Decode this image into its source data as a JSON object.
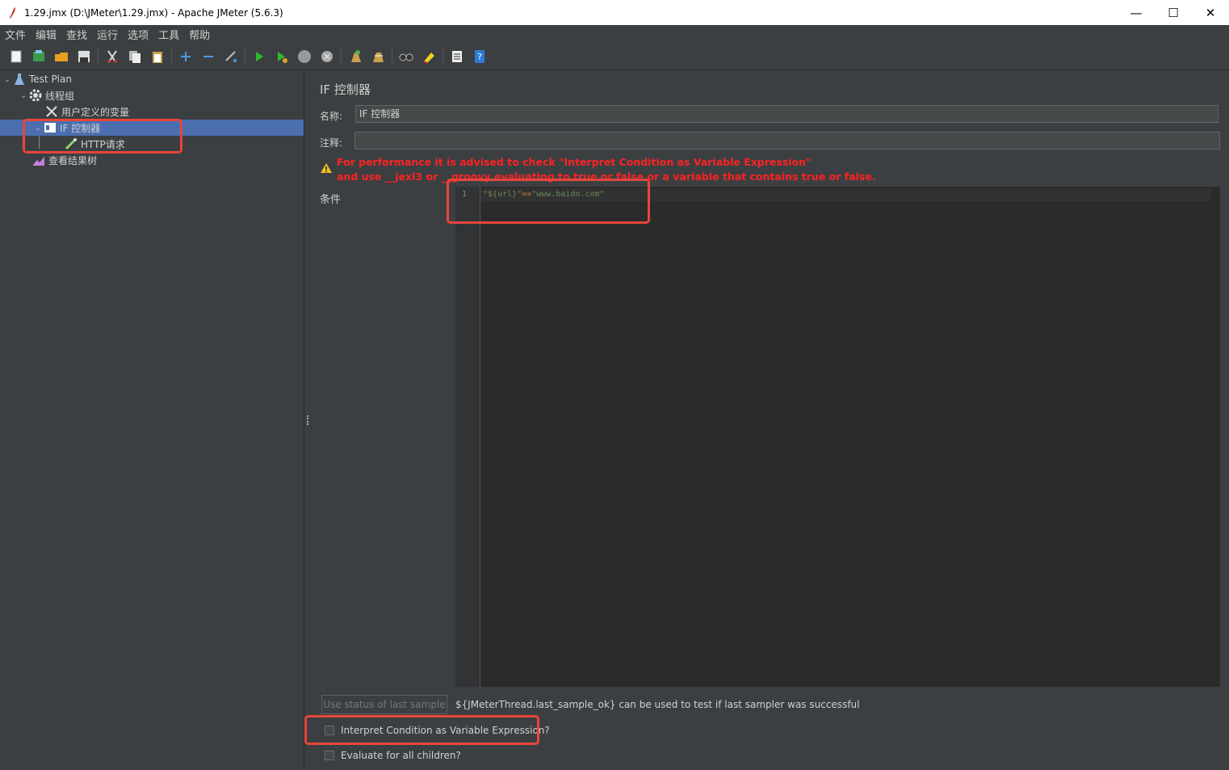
{
  "window": {
    "title": "1.29.jmx (D:\\JMeter\\1.29.jmx) - Apache JMeter (5.6.3)",
    "minimize": "—",
    "maximize": "☐",
    "close": "✕"
  },
  "menu": [
    "文件",
    "编辑",
    "查找",
    "运行",
    "选项",
    "工具",
    "帮助"
  ],
  "toolbar": [
    "new-icon",
    "templates-icon",
    "open-icon",
    "save-icon",
    "cut-icon",
    "copy-icon",
    "paste-icon",
    "expand-icon",
    "collapse-icon",
    "toggle-icon",
    "start-icon",
    "start-no-pause-icon",
    "stop-icon",
    "shutdown-icon",
    "clear-icon",
    "clear-all-icon",
    "search-icon",
    "reset-search-icon",
    "function-helper-icon",
    "help-icon"
  ],
  "tree": {
    "test_plan": "Test Plan",
    "thread_group": "线程组",
    "user_vars": "用户定义的变量",
    "if_controller": "IF 控制器",
    "http_request": "HTTP请求",
    "result_tree": "查看结果树"
  },
  "panel": {
    "title": "IF 控制器",
    "name_label": "名称:",
    "name_value": "IF 控制器",
    "comment_label": "注释:",
    "comment_value": "",
    "warning_line1": "For performance it is advised to check \"Interpret Condition as Variable Expression\"",
    "warning_line2": "and use __jexl3 or __groovy evaluating to true or false or a variable that contains true or false.",
    "condition_label": "条件",
    "line_number": "1",
    "code_part1": "\"${url}\"",
    "code_op": "==",
    "code_part2": "\"www.baido.com\"",
    "use_status_button": "Use status of last sample",
    "hint": "${JMeterThread.last_sample_ok} can be used to test if last sampler was successful",
    "interpret_checkbox": "Interpret Condition as Variable Expression?",
    "interpret_checked": false,
    "evaluate_checkbox": "Evaluate for all children?",
    "evaluate_checked": false
  },
  "colors": {
    "background": "#3c3f41",
    "selection": "#4b6eaf",
    "warning": "#ff2222",
    "annotation_box": "#e8453c"
  }
}
